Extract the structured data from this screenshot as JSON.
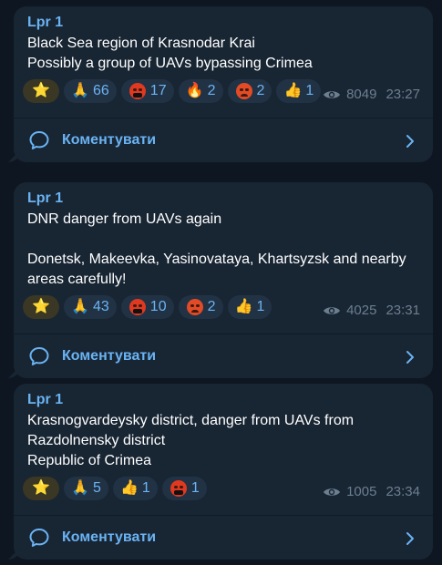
{
  "posts": [
    {
      "author": "Lpr 1",
      "text": "Black Sea region of Krasnodar Krai\nPossibly a group of UAVs bypassing Crimea",
      "reactions": [
        {
          "emoji": "⭐",
          "count": ""
        },
        {
          "emoji": "🙏",
          "count": "66"
        },
        {
          "emoji": "cursing-face",
          "count": "17"
        },
        {
          "emoji": "🔥",
          "count": "2"
        },
        {
          "emoji": "angry-face",
          "count": "2"
        },
        {
          "emoji": "👍",
          "count": "1"
        }
      ],
      "views": "8049",
      "time": "23:27",
      "comments_label": "Коментувати"
    },
    {
      "author": "Lpr 1",
      "text": "DNR danger from UAVs again\n\nDonetsk, Makeevka, Yasinovataya, Khartsyzsk and nearby areas carefully!",
      "reactions": [
        {
          "emoji": "⭐",
          "count": ""
        },
        {
          "emoji": "🙏",
          "count": "43"
        },
        {
          "emoji": "cursing-face",
          "count": "10"
        },
        {
          "emoji": "angry-face",
          "count": "2"
        },
        {
          "emoji": "👍",
          "count": "1"
        }
      ],
      "views": "4025",
      "time": "23:31",
      "comments_label": "Коментувати"
    },
    {
      "author": "Lpr 1",
      "text": "Krasnogvardeysky district, danger from UAVs from Razdolnensky district\nRepublic of Crimea",
      "reactions": [
        {
          "emoji": "⭐",
          "count": ""
        },
        {
          "emoji": "🙏",
          "count": "5"
        },
        {
          "emoji": "👍",
          "count": "1"
        },
        {
          "emoji": "cursing-face",
          "count": "1"
        }
      ],
      "views": "1005",
      "time": "23:34",
      "comments_label": "Коментувати"
    }
  ],
  "colors": {
    "background": "#0e1621",
    "bubble": "#182533",
    "accent": "#6ab3f3",
    "meta": "#6d7f8f"
  }
}
